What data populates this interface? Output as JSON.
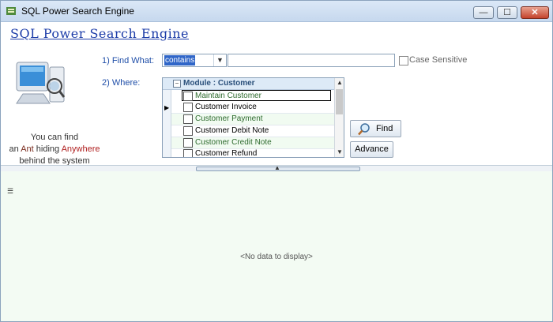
{
  "window": {
    "title": "SQL Power Search Engine",
    "minimize_glyph": "—",
    "maximize_glyph": "☐",
    "close_glyph": "✕"
  },
  "heading": "SQL Power Search Engine",
  "tagline": {
    "line1": "You can find",
    "line2_prefix": "an ",
    "ant": "Ant",
    "hiding": " hiding ",
    "anywhere": "Anywhere",
    "line3": "behind the system"
  },
  "find_what": {
    "label": "1) Find What:",
    "mode_value": "contains",
    "search_value": "",
    "case_sensitive_label": "Case Sensitive",
    "case_sensitive_checked": false
  },
  "where": {
    "label": "2) Where:",
    "group_label": "Module : Customer",
    "items": [
      {
        "label": "Maintain Customer",
        "checked": false
      },
      {
        "label": "Customer Invoice",
        "checked": false
      },
      {
        "label": "Customer Payment",
        "checked": false
      },
      {
        "label": "Customer Debit Note",
        "checked": false
      },
      {
        "label": "Customer Credit Note",
        "checked": false
      },
      {
        "label": "Customer Refund",
        "checked": false
      }
    ]
  },
  "buttons": {
    "find": "Find",
    "advance": "Advance"
  },
  "results": {
    "empty_text": "<No data to display>"
  },
  "colors": {
    "heading": "#1c3ca8",
    "label": "#1f4ea8",
    "alt_row_text": "#2e6b2e",
    "result_bg": "#f3fbf3"
  },
  "icons": {
    "app": "app-icon",
    "computer": "computer-search-icon",
    "find": "magnifier-icon"
  }
}
